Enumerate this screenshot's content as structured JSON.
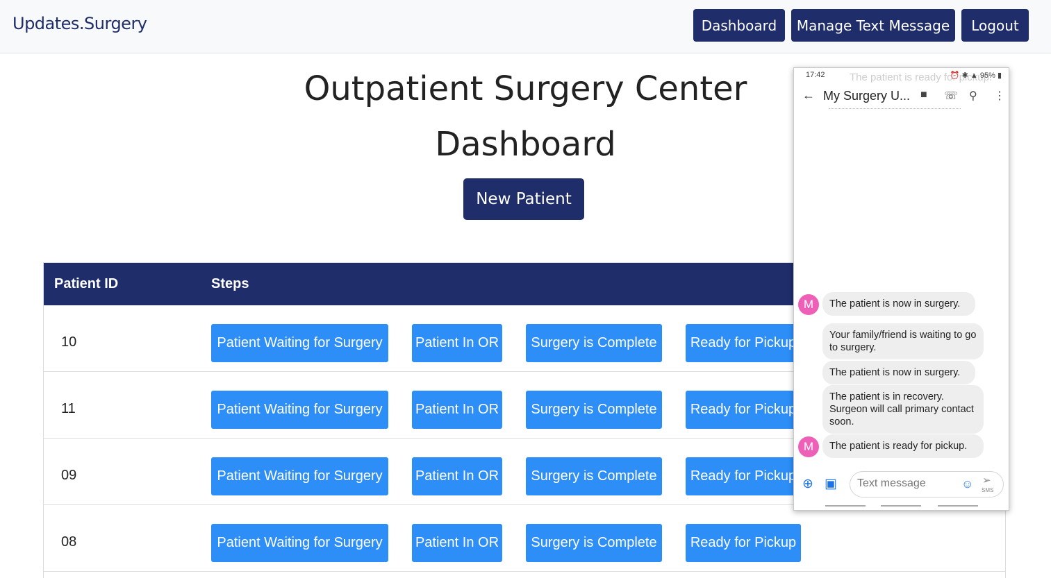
{
  "navbar": {
    "brand": "Updates.Surgery",
    "buttons": [
      "Dashboard",
      "Manage Text Message",
      "Logout"
    ]
  },
  "page": {
    "title_line1": "Outpatient Surgery Center",
    "title_line2": "Dashboard",
    "new_patient": "New Patient"
  },
  "table": {
    "headers": [
      "Patient ID",
      "Steps"
    ],
    "steps": [
      "Patient Waiting for Surgery",
      "Patient In OR",
      "Surgery is Complete",
      "Ready for Pickup"
    ],
    "rows": [
      {
        "id": "10"
      },
      {
        "id": "11"
      },
      {
        "id": "09"
      },
      {
        "id": "08"
      }
    ]
  },
  "phone": {
    "time": "17:42",
    "ghost_notification": "The patient is ready for pickup.",
    "status_right": "95%",
    "contact": "My Surgery U...",
    "avatar_letter": "M",
    "messages": [
      "The patient is now in surgery.",
      "Your family/friend is waiting to go to surgery.",
      "The patient is now in surgery.",
      "The patient is in recovery. Surgeon will call primary contact soon.",
      "The patient is ready for pickup."
    ],
    "input_placeholder": "Text message",
    "send_label": "SMS"
  },
  "colors": {
    "brand_navy": "#1f2d6b",
    "step_blue": "#2d8ef8",
    "avatar_pink": "#ee5fb8"
  }
}
